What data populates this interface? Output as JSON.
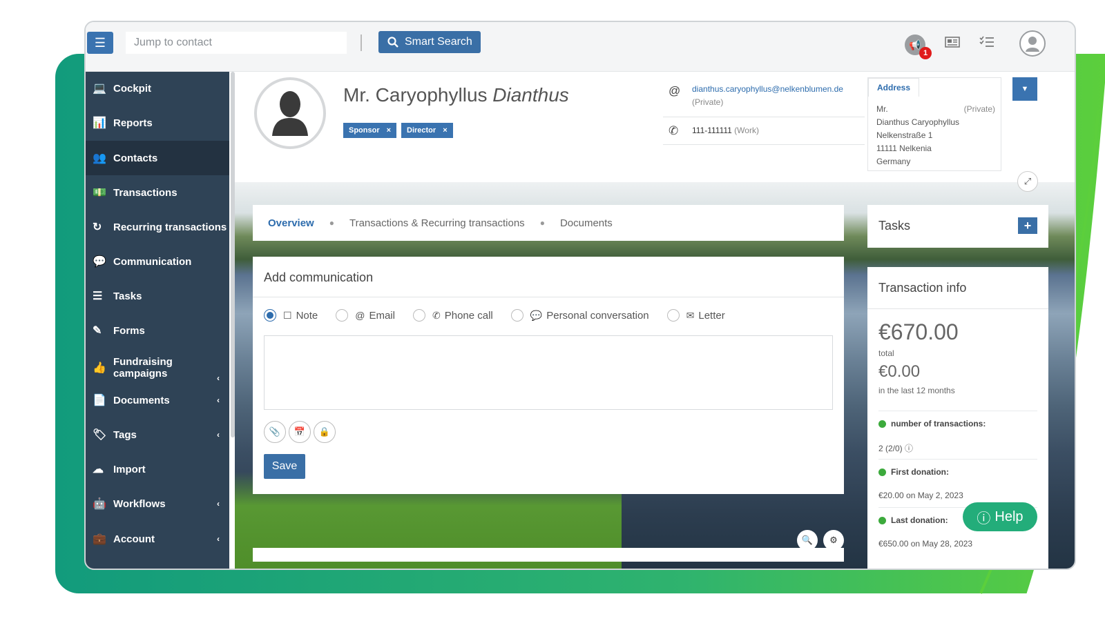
{
  "topbar": {
    "jump_placeholder": "Jump to contact",
    "smart_search_label": "Smart Search",
    "notification_count": "1"
  },
  "sidebar": {
    "items": [
      {
        "label": "Cockpit",
        "icon": "laptop-icon"
      },
      {
        "label": "Reports",
        "icon": "chart-icon"
      },
      {
        "label": "Contacts",
        "icon": "people-icon"
      },
      {
        "label": "Transactions",
        "icon": "money-icon"
      },
      {
        "label": "Recurring transactions",
        "icon": "recurring-icon"
      },
      {
        "label": "Communication",
        "icon": "chat-icon"
      },
      {
        "label": "Tasks",
        "icon": "tasks-icon"
      },
      {
        "label": "Forms",
        "icon": "edit-icon"
      },
      {
        "label": "Fundraising campaigns",
        "icon": "thumbs-up-icon"
      },
      {
        "label": "Documents",
        "icon": "document-icon"
      },
      {
        "label": "Tags",
        "icon": "tags-icon"
      },
      {
        "label": "Import",
        "icon": "cloud-upload-icon"
      },
      {
        "label": "Workflows",
        "icon": "robot-icon"
      },
      {
        "label": "Account",
        "icon": "briefcase-icon"
      }
    ]
  },
  "contact": {
    "name_first": "Mr. Caryophyllus",
    "name_last": "Dianthus",
    "tags": [
      "Sponsor",
      "Director"
    ],
    "email": "dianthus.caryophyllus@nelkenblumen.de",
    "email_type": "(Private)",
    "phone": "111-111111",
    "phone_type": "(Work)",
    "address": {
      "tab": "Address",
      "salutation": "Mr.",
      "type": "(Private)",
      "line1": "Dianthus Caryophyllus",
      "line2": "Nelkenstraße 1",
      "line3": "11111 Nelkenia",
      "line4": "Germany"
    }
  },
  "tabs": {
    "overview": "Overview",
    "transactions": "Transactions & Recurring transactions",
    "documents": "Documents"
  },
  "communication": {
    "title": "Add communication",
    "types": [
      "Note",
      "Email",
      "Phone call",
      "Personal conversation",
      "Letter"
    ],
    "selected": "Note",
    "save_label": "Save"
  },
  "tasks": {
    "title": "Tasks"
  },
  "transaction_info": {
    "title": "Transaction info",
    "total_amount": "€670.00",
    "total_label": "total",
    "recent_amount": "€0.00",
    "recent_label": "in the last 12 months",
    "count_label": "number of transactions:",
    "count_value": "2  (2/0)",
    "first_label": "First donation:",
    "first_value": "€20.00 on May 2, 2023",
    "last_label": "Last donation:",
    "last_value": "€650.00 on May 28, 2023"
  },
  "help": {
    "label": "Help"
  },
  "colors": {
    "primary": "#3a73b0",
    "sidebar": "#2f4356",
    "accent_green": "#23ad7a"
  }
}
